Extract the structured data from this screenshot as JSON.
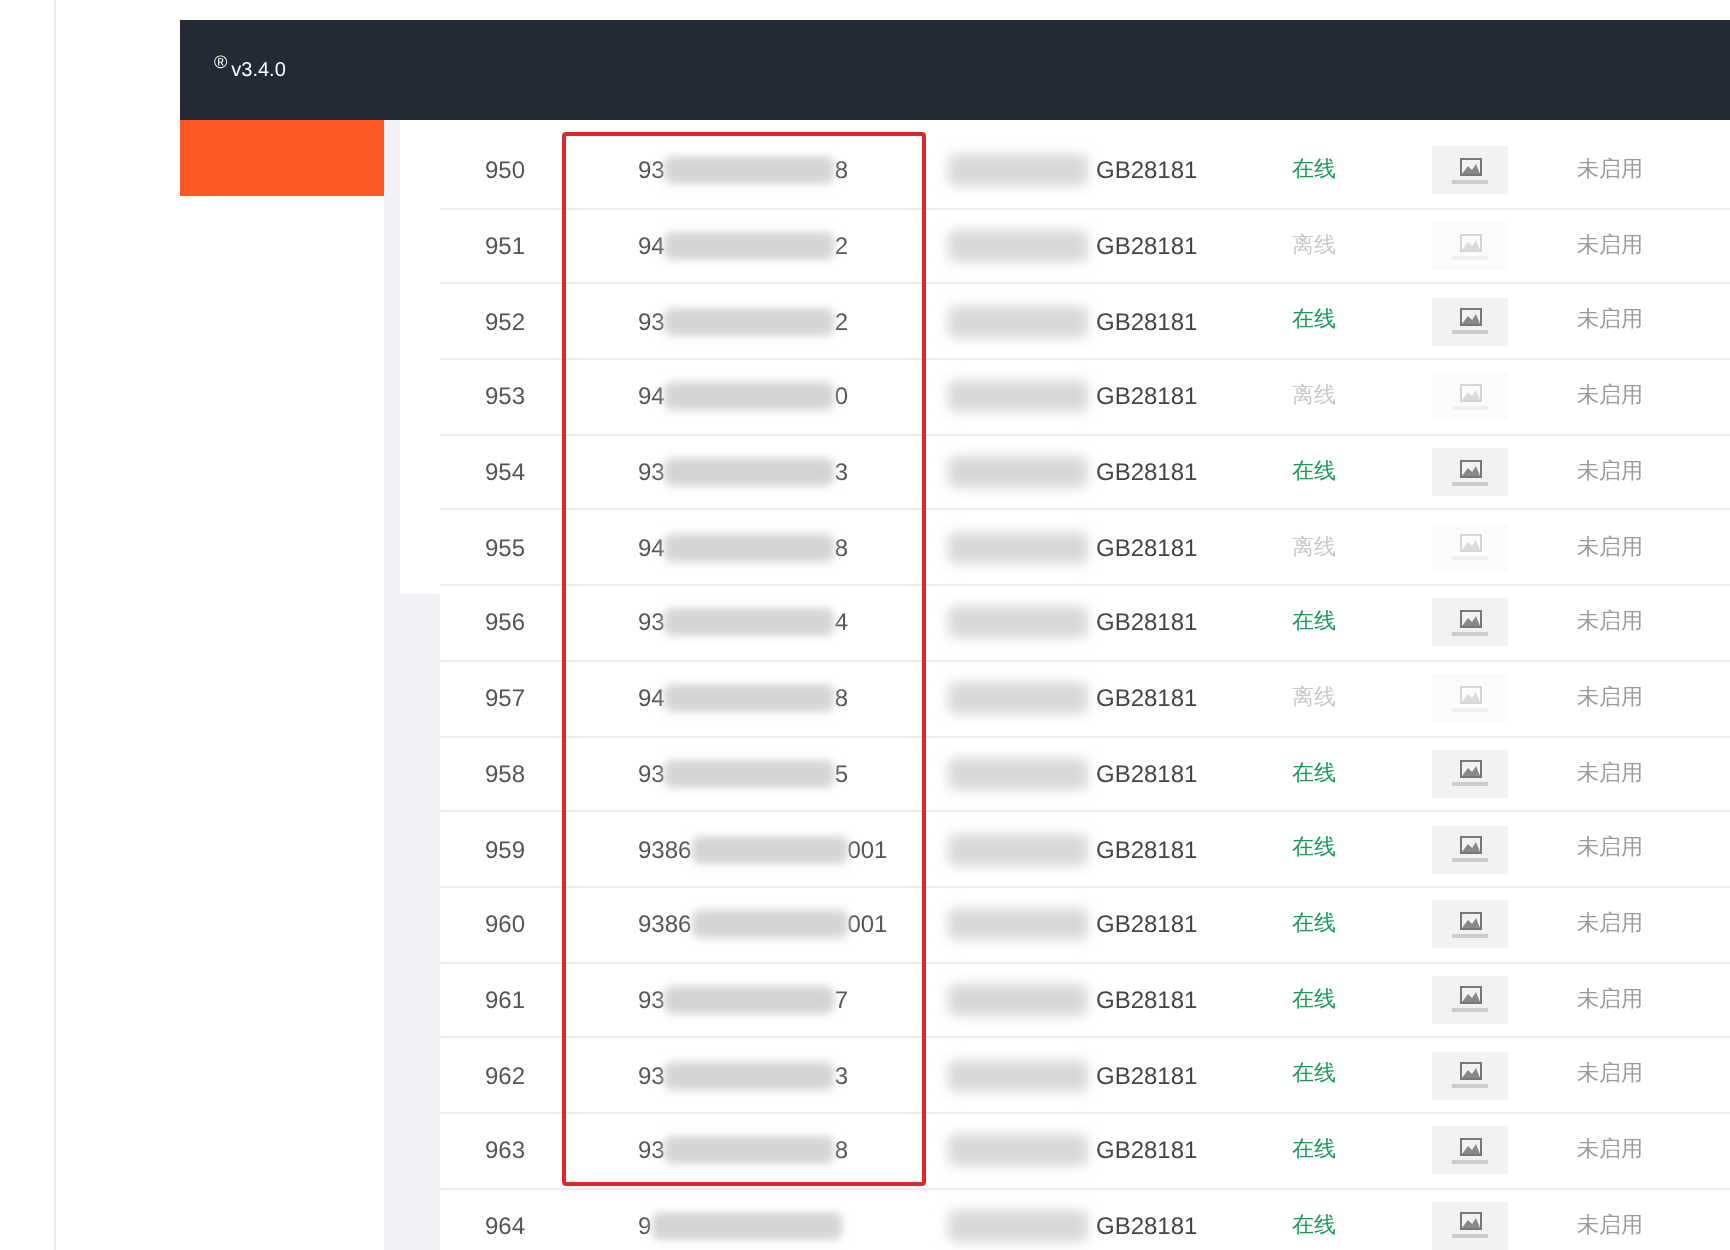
{
  "header": {
    "registered_mark": "®",
    "version": "v3.4.0"
  },
  "rows": [
    {
      "index": "950",
      "id_prefix": "93",
      "id_suffix": "8",
      "protocol": "GB28181",
      "status": "在线",
      "online": true,
      "stream": "未启用"
    },
    {
      "index": "951",
      "id_prefix": "94",
      "id_suffix": "2",
      "protocol": "GB28181",
      "status": "离线",
      "online": false,
      "stream": "未启用"
    },
    {
      "index": "952",
      "id_prefix": "93",
      "id_suffix": "2",
      "protocol": "GB28181",
      "status": "在线",
      "online": true,
      "stream": "未启用"
    },
    {
      "index": "953",
      "id_prefix": "94",
      "id_suffix": "0",
      "protocol": "GB28181",
      "status": "离线",
      "online": false,
      "stream": "未启用"
    },
    {
      "index": "954",
      "id_prefix": "93",
      "id_suffix": "3",
      "protocol": "GB28181",
      "status": "在线",
      "online": true,
      "stream": "未启用"
    },
    {
      "index": "955",
      "id_prefix": "94",
      "id_suffix": "8",
      "protocol": "GB28181",
      "status": "离线",
      "online": false,
      "stream": "未启用"
    },
    {
      "index": "956",
      "id_prefix": "93",
      "id_suffix": "4",
      "protocol": "GB28181",
      "status": "在线",
      "online": true,
      "stream": "未启用"
    },
    {
      "index": "957",
      "id_prefix": "94",
      "id_suffix": "8",
      "protocol": "GB28181",
      "status": "离线",
      "online": false,
      "stream": "未启用"
    },
    {
      "index": "958",
      "id_prefix": "93",
      "id_suffix": "5",
      "protocol": "GB28181",
      "status": "在线",
      "online": true,
      "stream": "未启用"
    },
    {
      "index": "959",
      "id_prefix": "9386",
      "id_suffix": "001",
      "protocol": "GB28181",
      "status": "在线",
      "online": true,
      "stream": "未启用"
    },
    {
      "index": "960",
      "id_prefix": "9386",
      "id_suffix": "001",
      "protocol": "GB28181",
      "status": "在线",
      "online": true,
      "stream": "未启用"
    },
    {
      "index": "961",
      "id_prefix": "93",
      "id_suffix": "7",
      "protocol": "GB28181",
      "status": "在线",
      "online": true,
      "stream": "未启用"
    },
    {
      "index": "962",
      "id_prefix": "93",
      "id_suffix": "3",
      "protocol": "GB28181",
      "status": "在线",
      "online": true,
      "stream": "未启用"
    },
    {
      "index": "963",
      "id_prefix": "93",
      "id_suffix": "8",
      "protocol": "GB28181",
      "status": "在线",
      "online": true,
      "stream": "未启用"
    },
    {
      "index": "964",
      "id_prefix": "9",
      "protocol": "GB28181",
      "status": "在线",
      "online": true,
      "stream": "未启用"
    }
  ]
}
